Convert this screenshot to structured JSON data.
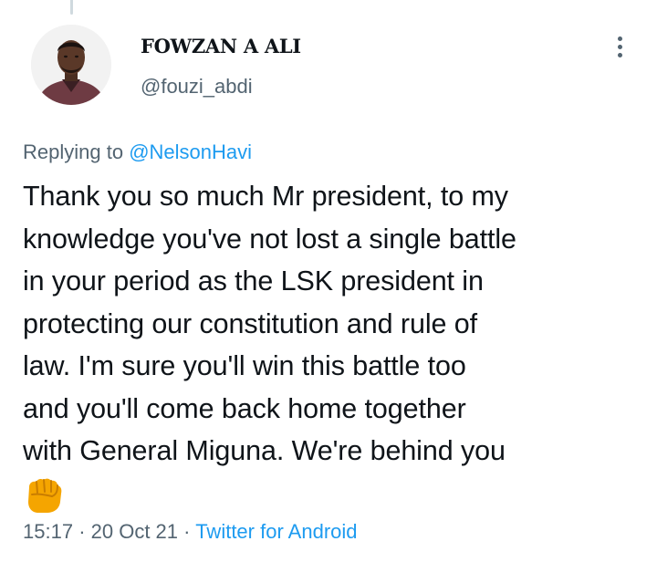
{
  "tweet": {
    "author_name": "FOWZAN A ALI",
    "author_handle": "@fouzi_abdi",
    "replying_prefix": "Replying to",
    "replying_to": "@NelsonHavi",
    "lines": [
      "Thank you so much Mr president, to my",
      "knowledge you've not lost a single battle",
      "in your period as the LSK president in",
      "protecting our constitution and rule of",
      "law. I'm sure you'll win this battle too",
      "and you'll come back home together",
      "with General Miguna. We're behind you"
    ],
    "emoji": "oncoming-fist-emoji",
    "time": "15:17",
    "date": "20 Oct 21",
    "separator": "·",
    "source": "Twitter for Android"
  },
  "icons": {
    "more": "more-options-icon"
  },
  "colors": {
    "text": "#0f1419",
    "secondary": "#536471",
    "link": "#1d9bf0",
    "background": "#ffffff"
  }
}
